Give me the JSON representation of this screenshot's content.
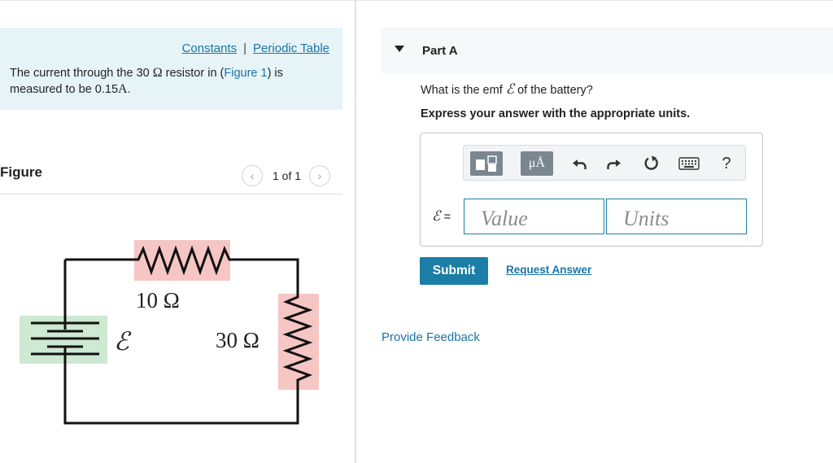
{
  "problem": {
    "links": {
      "constants": "Constants",
      "separator": "|",
      "periodic_table": "Periodic Table"
    },
    "text_part1": "The current through the 30 ",
    "text_ohm": "Ω",
    "text_part2": " resistor in (",
    "figure_ref": "Figure 1",
    "text_part3": ") is measured to be 0.15",
    "text_unit": "A",
    "text_end": "."
  },
  "figure": {
    "title": "Figure",
    "pager": {
      "prev": "‹",
      "label": "1 of 1",
      "next": "›"
    },
    "circuit": {
      "resistor_top_label": "10 Ω",
      "resistor_right_label": "30 Ω",
      "battery_label": "ℰ",
      "colors": {
        "resistor_bg": "#f6c6c4",
        "battery_bg": "#cde9d1",
        "wire": "#111111"
      }
    }
  },
  "part_a": {
    "title": "Part A",
    "question_pre": "What is the emf ",
    "question_symbol": "ℰ",
    "question_post": " of the battery?",
    "instruction": "Express your answer with the appropriate units.",
    "toolbar": {
      "templates_icon": "templates-icon",
      "units_label": "μÅ",
      "undo_icon": "undo-icon",
      "redo_icon": "redo-icon",
      "reset_icon": "reset-icon",
      "keyboard_icon": "keyboard-icon",
      "help_label": "?"
    },
    "equation_symbol": "ℰ",
    "equation_equals": "=",
    "value_placeholder": "Value",
    "units_placeholder": "Units",
    "submit_label": "Submit",
    "request_answer_label": "Request Answer"
  },
  "feedback_label": "Provide Feedback",
  "colors": {
    "accent": "#1a7ea6",
    "link": "#1a74a8",
    "problem_bg": "#e6f4f7"
  }
}
